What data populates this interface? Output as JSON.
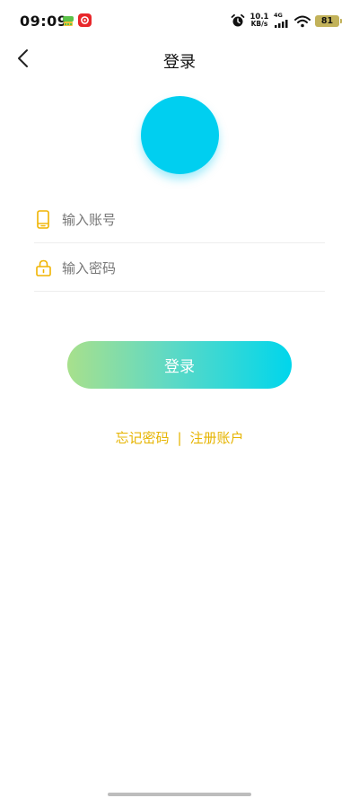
{
  "status_bar": {
    "time": "09:09",
    "net_speed_value": "10.1",
    "net_speed_unit": "KB/s",
    "network_type": "4G",
    "battery_level": "81",
    "icons": [
      "app-notification-icon",
      "app-notification-icon-red",
      "alarm-icon",
      "signal-icon",
      "wifi-icon",
      "battery-icon"
    ]
  },
  "nav": {
    "title": "登录",
    "back_icon": "chevron-left-icon"
  },
  "form": {
    "account": {
      "placeholder": "输入账号",
      "value": "",
      "icon": "phone-icon"
    },
    "password": {
      "placeholder": "输入密码",
      "value": "",
      "icon": "lock-icon"
    }
  },
  "login_button_label": "登录",
  "links": {
    "forgot": "忘记密码",
    "separator": "|",
    "register": "注册账户"
  },
  "colors": {
    "accent_cyan": "#00cff0",
    "accent_green": "#a8e08c",
    "link_yellow": "#e6b400",
    "icon_yellow": "#f0b400"
  }
}
